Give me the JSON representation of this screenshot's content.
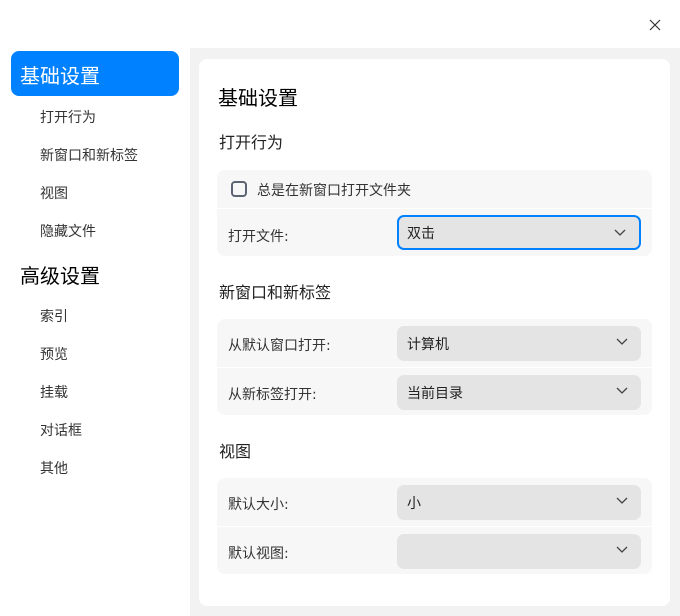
{
  "sidebar": {
    "groups": [
      {
        "label": "基础设置",
        "items": [
          "打开行为",
          "新窗口和新标签",
          "视图",
          "隐藏文件"
        ]
      },
      {
        "label": "高级设置",
        "items": [
          "索引",
          "预览",
          "挂载",
          "对话框",
          "其他"
        ]
      }
    ]
  },
  "main": {
    "title": "基础设置",
    "sections": [
      {
        "title": "打开行为",
        "checkbox": {
          "label": "总是在新窗口打开文件夹",
          "checked": false
        },
        "rows": [
          {
            "label": "打开文件:",
            "value": "双击"
          }
        ]
      },
      {
        "title": "新窗口和新标签",
        "rows": [
          {
            "label": "从默认窗口打开:",
            "value": "计算机"
          },
          {
            "label": "从新标签打开:",
            "value": "当前目录"
          }
        ]
      },
      {
        "title": "视图",
        "rows": [
          {
            "label": "默认大小:",
            "value": "小"
          },
          {
            "label": "默认视图:",
            "value": ""
          }
        ]
      }
    ]
  },
  "colors": {
    "accent": "#0081ff"
  }
}
